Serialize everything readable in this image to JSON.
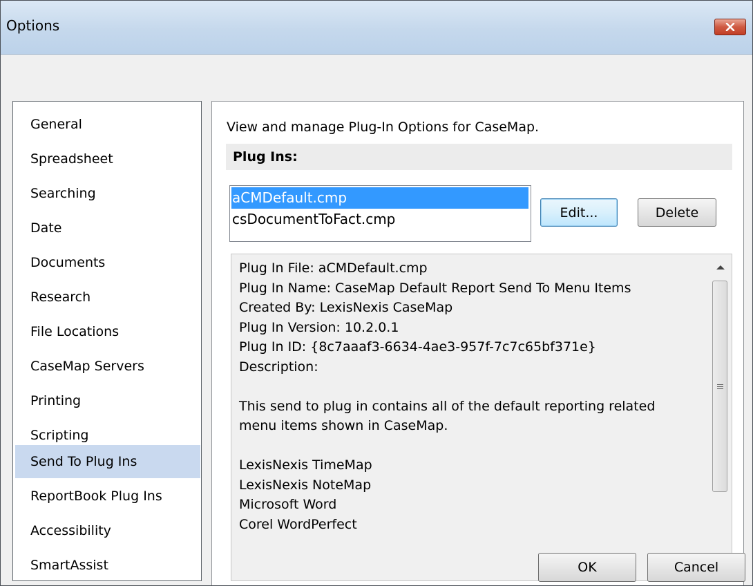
{
  "window": {
    "title": "Options"
  },
  "nav": {
    "items": [
      {
        "label": "General"
      },
      {
        "label": "Spreadsheet"
      },
      {
        "label": "Searching"
      },
      {
        "label": "Date"
      },
      {
        "label": "Documents"
      },
      {
        "label": "Research"
      },
      {
        "label": "File Locations"
      },
      {
        "label": "CaseMap Servers"
      },
      {
        "label": "Printing"
      },
      {
        "label": "Scripting"
      },
      {
        "label": "Send To Plug Ins"
      },
      {
        "label": "ReportBook Plug Ins"
      },
      {
        "label": "Accessibility"
      },
      {
        "label": "SmartAssist"
      }
    ],
    "selected": "Send To Plug Ins"
  },
  "main": {
    "intro": "View and manage Plug-In Options for CaseMap.",
    "section_header": "Plug Ins:",
    "plugins": [
      {
        "name": "aCMDefault.cmp"
      },
      {
        "name": "csDocumentToFact.cmp"
      }
    ],
    "selected_plugin": "aCMDefault.cmp",
    "edit_label": "Edit...",
    "delete_label": "Delete",
    "details_lines": [
      "Plug In File: aCMDefault.cmp",
      "Plug In Name: CaseMap Default Report Send To Menu Items",
      "Created By: LexisNexis CaseMap",
      "Plug In Version: 10.2.0.1",
      "Plug In ID: {8c7aaaf3-6634-4ae3-957f-7c7c65bf371e}",
      "Description:",
      "",
      "This send to plug in contains all of the default reporting related",
      "menu items shown in CaseMap.",
      "",
      "LexisNexis TimeMap",
      "LexisNexis NoteMap",
      "Microsoft Word",
      "Corel WordPerfect"
    ]
  },
  "footer": {
    "ok_label": "OK",
    "cancel_label": "Cancel"
  },
  "colors": {
    "selection": "#3399ff",
    "nav_selected": "#c9d9ef",
    "close_button": "#c8472e"
  }
}
